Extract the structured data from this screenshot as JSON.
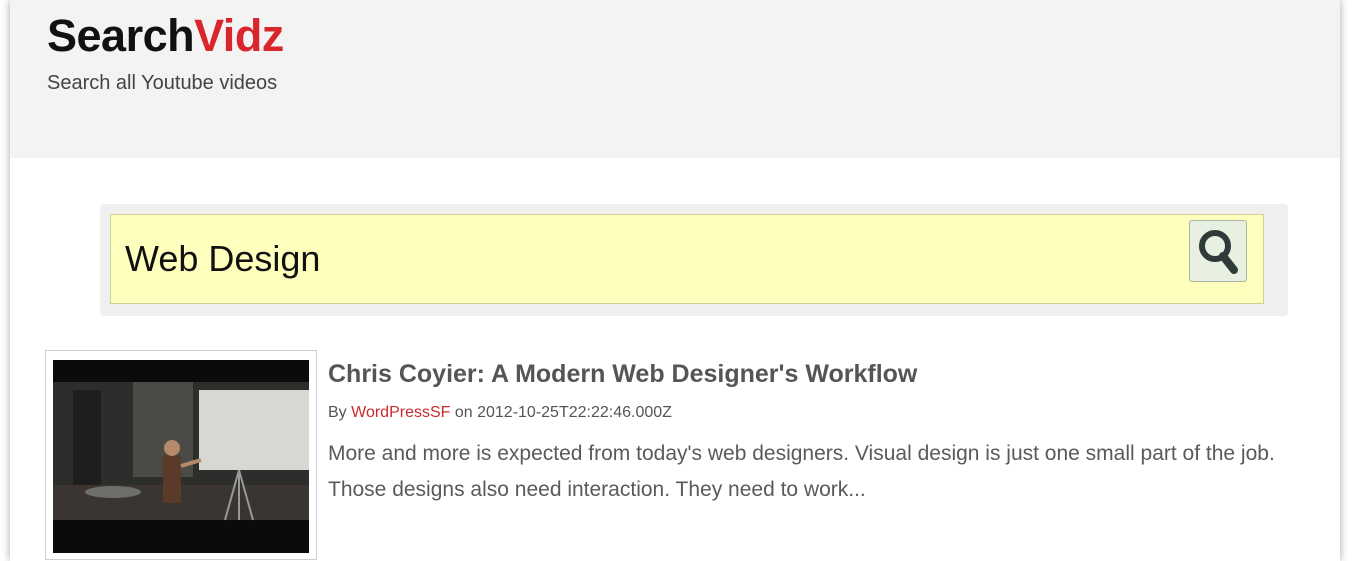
{
  "header": {
    "logo_part1": "Search",
    "logo_part2": "Vidz",
    "tagline": "Search all Youtube videos"
  },
  "search": {
    "value": "Web Design",
    "button_icon": "magnifier-icon"
  },
  "results": [
    {
      "title": "Chris Coyier: A Modern Web Designer's Workflow",
      "by_label": "By",
      "author": "WordPressSF",
      "on_label": "on",
      "date": "2012-10-25T22:22:46.000Z",
      "description": "More and more is expected from today's web designers. Visual design is just one small part of the job. Those designs also need interaction. They need to work..."
    }
  ],
  "colors": {
    "brand_red": "#d9262c",
    "search_bg": "#ffffbd",
    "header_bg": "#f3f3f3",
    "author_link": "#cc2a2a"
  }
}
